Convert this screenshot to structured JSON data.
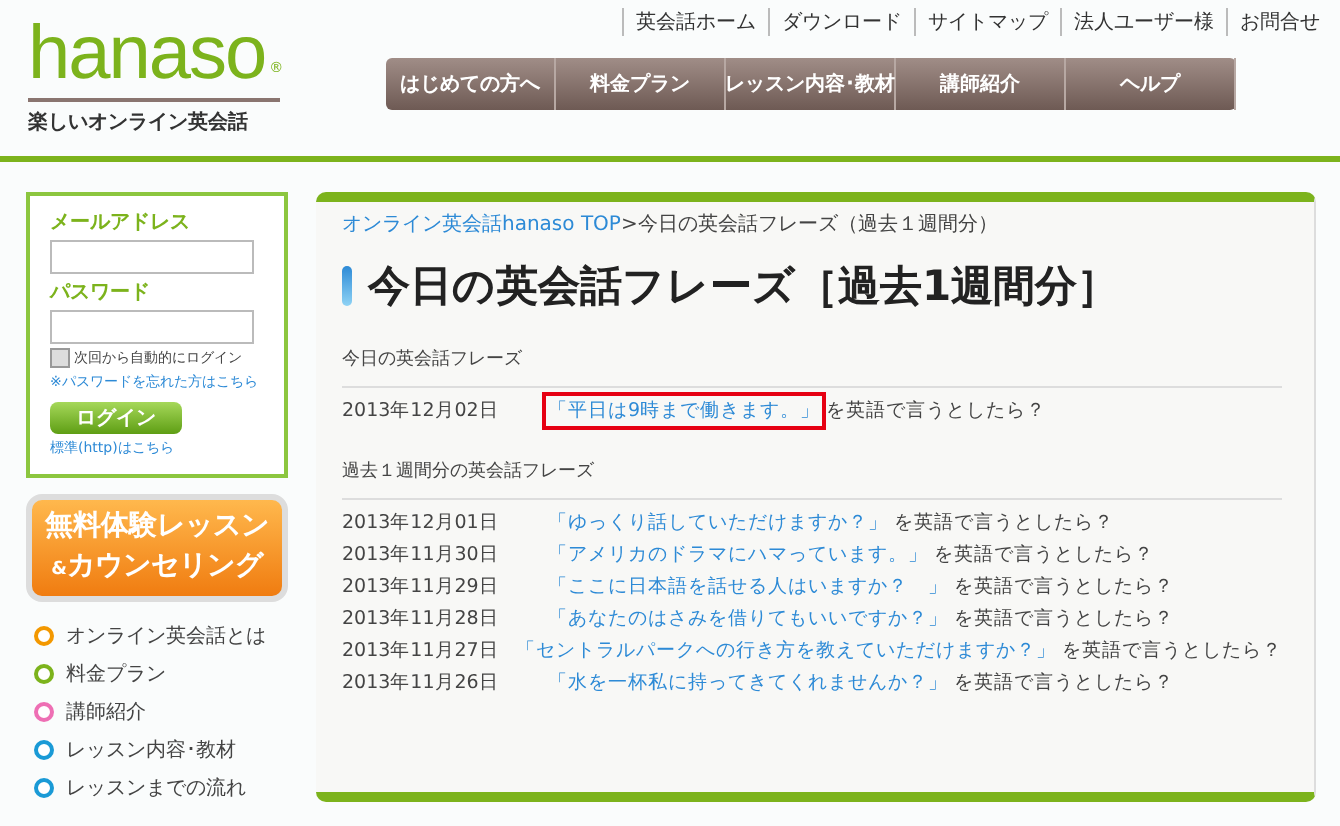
{
  "logo": {
    "wordmark": "hanaso",
    "registered": "®",
    "tagline": "楽しいオンライン英会話"
  },
  "top_links": [
    "英会話ホーム",
    "ダウンロード",
    "サイトマップ",
    "法人ユーザー様",
    "お問合せ"
  ],
  "nav": [
    "はじめての方へ",
    "料金プラン",
    "レッスン内容･教材",
    "講師紹介",
    "ヘルプ"
  ],
  "login": {
    "email_label": "メールアドレス",
    "password_label": "パスワード",
    "remember": {
      "label": "次回から自動的にログイン",
      "checked": false
    },
    "forgot_link": "※パスワードを忘れた方はこちら",
    "button": "ログイン",
    "standard_link": "標準(http)はこちら"
  },
  "trial_button": {
    "line_1": "無料体験レッスン",
    "line_2_prefix": "&",
    "line_2": "カウンセリング"
  },
  "side_menu": [
    {
      "label": "オンライン英会話とは",
      "color": "#f39800"
    },
    {
      "label": "料金プラン",
      "color": "#7cb31c"
    },
    {
      "label": "講師紹介",
      "color": "#ee6fb4"
    },
    {
      "label": "レッスン内容･教材",
      "color": "#1a9ad6"
    },
    {
      "label": "レッスンまでの流れ",
      "color": "#1a9ad6"
    }
  ],
  "breadcrumb": {
    "link": "オンライン英会話hanaso TOP",
    "current": ">今日の英会話フレーズ（過去１週間分）"
  },
  "title": "今日の英会話フレーズ［過去1週間分］",
  "sections": [
    {
      "heading": "今日の英会話フレーズ",
      "rows": [
        {
          "date": "2013年12月02日",
          "phrase": "「平日は9時まで働きます。」",
          "suffix": "を英語で言うとしたら？",
          "highlighted": true
        }
      ]
    },
    {
      "heading": "過去１週間分の英会話フレーズ",
      "rows": [
        {
          "date": "2013年12月01日",
          "phrase": "「ゆっくり話していただけますか？」",
          "suffix": "を英語で言うとしたら？",
          "highlighted": false
        },
        {
          "date": "2013年11月30日",
          "phrase": "「アメリカのドラマにハマっています。」",
          "suffix": "を英語で言うとしたら？",
          "highlighted": false
        },
        {
          "date": "2013年11月29日",
          "phrase": "「ここに日本語を話せる人はいますか？　」",
          "suffix": "を英語で言うとしたら？",
          "highlighted": false
        },
        {
          "date": "2013年11月28日",
          "phrase": "「あなたのはさみを借りてもいいですか？」",
          "suffix": "を英語で言うとしたら？",
          "highlighted": false
        },
        {
          "date": "2013年11月27日",
          "phrase": "「セントラルパークへの行き方を教えていただけますか？」",
          "suffix": "を英語で言うとしたら？",
          "highlighted": false
        },
        {
          "date": "2013年11月26日",
          "phrase": "「水を一杯私に持ってきてくれませんか？」",
          "suffix": "を英語で言うとしたら？",
          "highlighted": false
        }
      ]
    }
  ]
}
